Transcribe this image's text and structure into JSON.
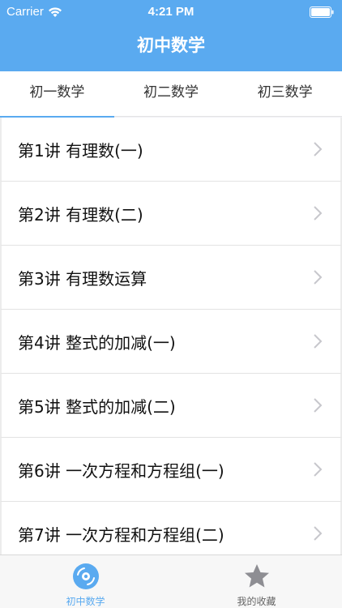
{
  "status": {
    "carrier": "Carrier",
    "time": "4:21 PM"
  },
  "navbar": {
    "title": "初中数学"
  },
  "tabs": [
    {
      "label": "初一数学",
      "active": true
    },
    {
      "label": "初二数学",
      "active": false
    },
    {
      "label": "初三数学",
      "active": false
    }
  ],
  "lessons": [
    {
      "label": "第1讲 有理数(一)"
    },
    {
      "label": "第2讲 有理数(二)"
    },
    {
      "label": "第3讲 有理数运算"
    },
    {
      "label": "第4讲 整式的加减(一)"
    },
    {
      "label": "第5讲 整式的加减(二)"
    },
    {
      "label": "第6讲 一次方程和方程组(一)"
    },
    {
      "label": "第7讲 一次方程和方程组(二)"
    }
  ],
  "tabbar": [
    {
      "label": "初中数学",
      "icon": "disc-icon",
      "active": true
    },
    {
      "label": "我的收藏",
      "icon": "star-icon",
      "active": false
    }
  ],
  "colors": {
    "accent": "#5aaaf0",
    "background": "#efeff4"
  }
}
